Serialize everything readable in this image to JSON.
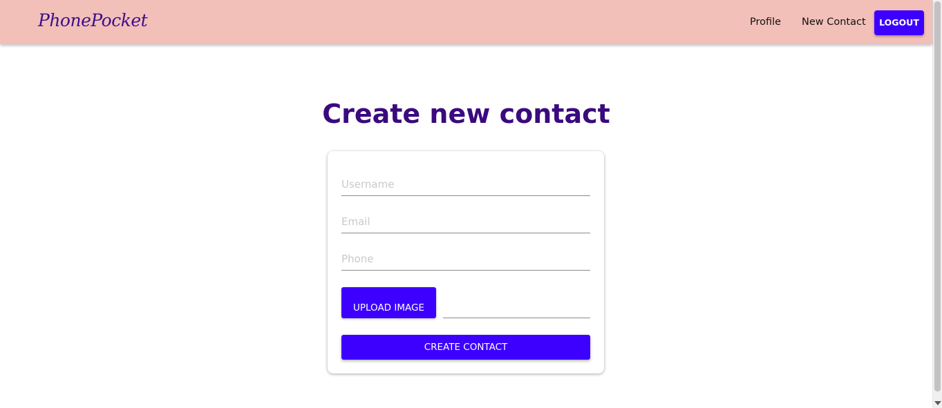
{
  "header": {
    "logo": "PhonePocket",
    "nav": {
      "profile": "Profile",
      "new_contact": "New Contact"
    },
    "logout_label": "LOGOUT",
    "background_color": "#f2c0b9"
  },
  "main": {
    "title": "Create new contact",
    "form": {
      "username": {
        "placeholder": "Username",
        "value": ""
      },
      "email": {
        "placeholder": "Email",
        "value": ""
      },
      "phone": {
        "placeholder": "Phone",
        "value": ""
      },
      "upload_label": "UPLOAD IMAGE",
      "file_name": "",
      "submit_label": "CREATE CONTACT"
    }
  },
  "colors": {
    "accent": "#3d00ff",
    "title": "#3a0a7e"
  }
}
